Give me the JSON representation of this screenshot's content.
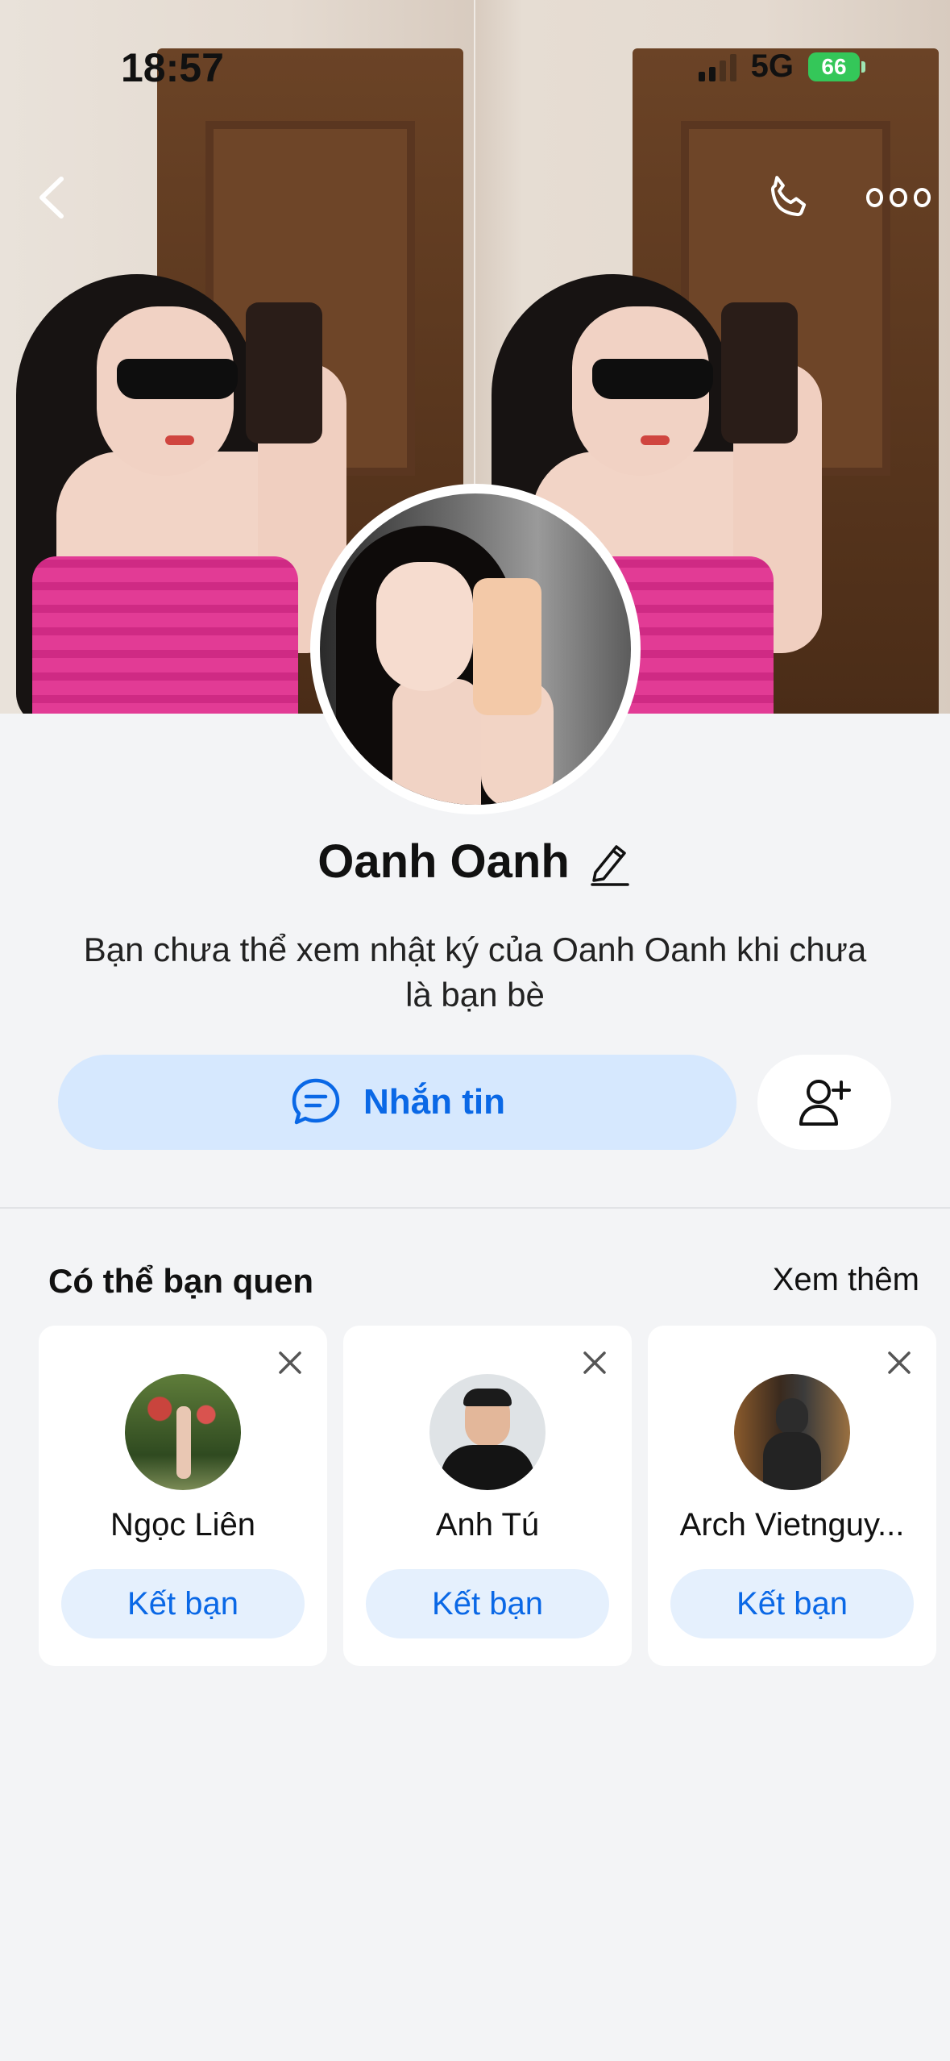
{
  "status_bar": {
    "time": "18:57",
    "network": "5G",
    "battery": "66"
  },
  "header": {
    "back_icon": "chevron-left-icon",
    "call_icon": "phone-icon",
    "more_icon": "more-dots-icon"
  },
  "profile": {
    "name": "Oanh Oanh",
    "edit_icon": "pencil-icon",
    "note": "Bạn chưa thể xem nhật ký của Oanh Oanh khi chưa là bạn bè"
  },
  "actions": {
    "message_label": "Nhắn tin",
    "message_icon": "chat-bubble-icon",
    "add_friend_icon": "add-user-icon"
  },
  "suggestions": {
    "title": "Có thể bạn quen",
    "see_more": "Xem thêm",
    "items": [
      {
        "name": "Ngọc Liên",
        "button": "Kết bạn"
      },
      {
        "name": "Anh Tú",
        "button": "Kết bạn"
      },
      {
        "name": "Arch Vietnguy...",
        "button": "Kết bạn"
      }
    ]
  },
  "colors": {
    "accent": "#0a68e6",
    "accent_bg": "#d6e8fe",
    "battery": "#34c759"
  }
}
